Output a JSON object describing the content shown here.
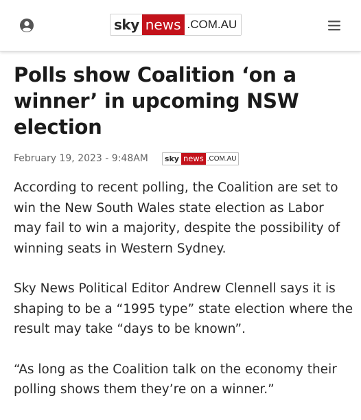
{
  "header": {
    "logo": {
      "sky": "sky",
      "news": "news",
      "domain": ".COM.AU"
    },
    "icons": {
      "account": "user-icon",
      "menu": "menu-icon"
    }
  },
  "article": {
    "title": "Polls show Coalition ‘on a winner’ in upcoming NSW election",
    "date": "February 19, 2023 - 9:48AM",
    "source_logo": {
      "sky": "sky",
      "news": "news",
      "domain": ".COM.AU"
    },
    "paragraphs": [
      "According to recent polling, the Coalition are set to win the New South Wales state election as Labor may fail to win a majority, despite the possibility of winning seats in Western Sydney.",
      "Sky News Political Editor Andrew Clennell says it is shaping to be a “1995 type” state election where the result may take “days to be known”.",
      "“As long as the Coalition talk on the economy their polling shows them they’re on a winner.”"
    ]
  },
  "colors": {
    "brand_red": "#c3121b",
    "text": "#1b1b1b",
    "meta_text": "#666666"
  }
}
